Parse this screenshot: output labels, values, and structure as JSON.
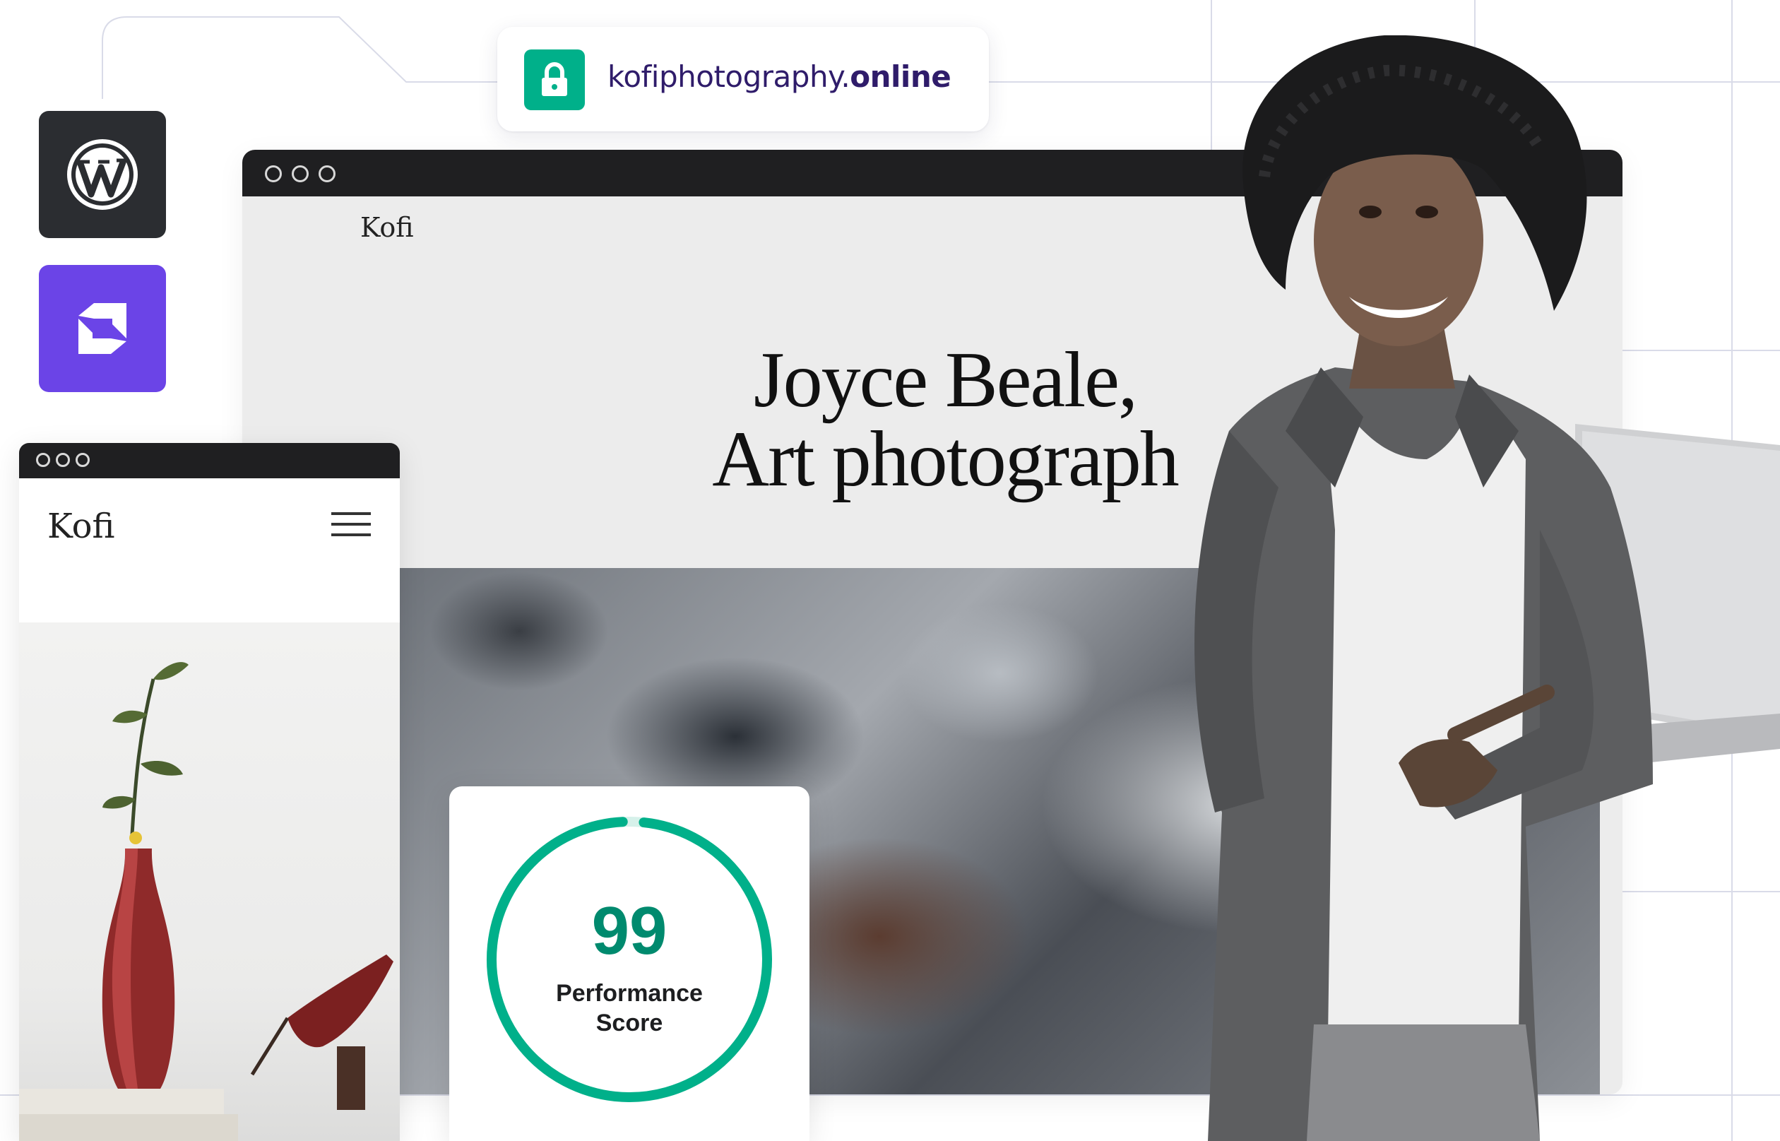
{
  "address_bar": {
    "domain_prefix": "kofiphotography.",
    "domain_tld": "online",
    "lock_icon": "lock-icon",
    "accent_color": "#00b08a"
  },
  "side_icons": [
    {
      "name": "wordpress-logo-icon",
      "color": "#2b2d31"
    },
    {
      "name": "hostinger-builder-logo-icon",
      "color": "#6b44e7"
    }
  ],
  "desktop_site": {
    "brand": "Kofi",
    "hero_line_1": "Joyce Beale,",
    "hero_line_2": "Art photograph"
  },
  "mobile_site": {
    "brand": "Kofi",
    "menu_icon": "hamburger-menu-icon"
  },
  "performance": {
    "score": "99",
    "score_value": 99,
    "label_line_1": "Performance",
    "label_line_2": "Score",
    "ring_color": "#00b08a"
  }
}
